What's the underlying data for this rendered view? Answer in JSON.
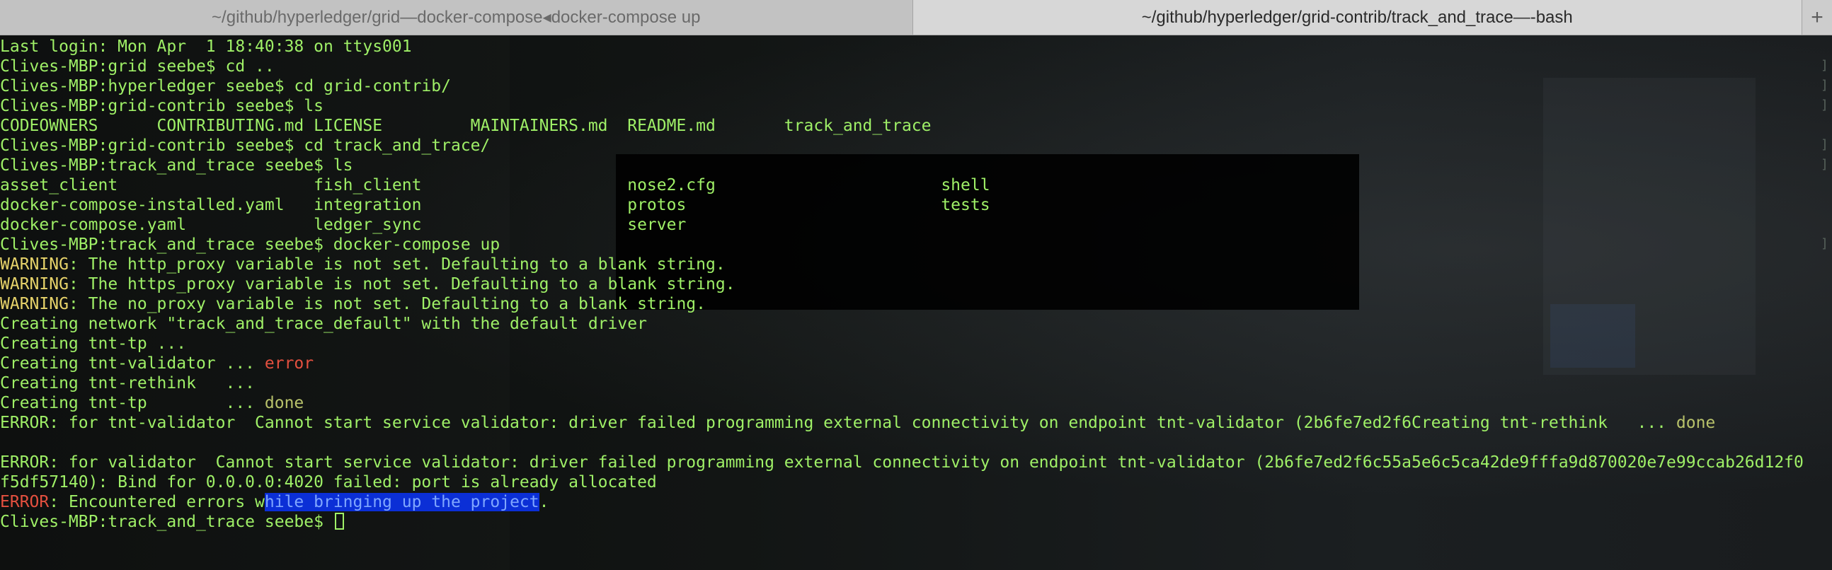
{
  "tabs": [
    {
      "title_path": "~/github/hyperledger/grid",
      "title_sep": " — ",
      "title_proc": "docker-compose",
      "title_arrow": " ◂ ",
      "title_cmd": "docker-compose up",
      "active": false
    },
    {
      "title_path": "~/github/hyperledger/grid-contrib/track_and_trace",
      "title_sep": " — ",
      "title_proc": "-bash",
      "active": true
    }
  ],
  "new_tab_label": "+",
  "terminal": {
    "login": "Last login: Mon Apr  1 18:40:38 on ttys001",
    "p1": "Clives-MBP:grid seebe$ cd ..",
    "p2": "Clives-MBP:hyperledger seebe$ cd grid-contrib/",
    "p3": "Clives-MBP:grid-contrib seebe$ ls",
    "ls1": "CODEOWNERS      CONTRIBUTING.md LICENSE         MAINTAINERS.md  README.md       track_and_trace",
    "p4": "Clives-MBP:grid-contrib seebe$ cd track_and_trace/",
    "p5": "Clives-MBP:track_and_trace seebe$ ls",
    "ls2a": "asset_client                    fish_client                     nose2.cfg                       shell",
    "ls2b": "docker-compose-installed.yaml   integration                     protos                          tests",
    "ls2c": "docker-compose.yaml             ledger_sync                     server",
    "p6": "Clives-MBP:track_and_trace seebe$ docker-compose up",
    "warn_label": "WARNING",
    "w1": ": The http_proxy variable is not set. Defaulting to a blank string.",
    "w2": ": The https_proxy variable is not set. Defaulting to a blank string.",
    "w3": ": The no_proxy variable is not set. Defaulting to a blank string.",
    "net": "Creating network \"track_and_trace_default\" with the default driver",
    "c1": "Creating tnt-tp ...",
    "c2": "Creating tnt-validator ... ",
    "c2_status": "error",
    "c3": "Creating tnt-rethink   ...",
    "c4": "Creating tnt-tp        ... ",
    "c4_status": "done",
    "e1": "ERROR: for tnt-validator  Cannot start service validator: driver failed programming external connectivity on endpoint tnt-validator (2b6fe7ed2f6Creating tnt-rethink   ... ",
    "e1_status": "done",
    "e2": "ERROR: for validator  Cannot start service validator: driver failed programming external connectivity on endpoint tnt-validator (2b6fe7ed2f6c55a5e6c5ca42de9fffa9d870020e7e99ccab26d12f0",
    "e2b": "f5df57140): Bind for 0.0.0.0:4020 failed: port is already allocated",
    "err_label": "ERROR",
    "e3_pre": ": Encountered errors w",
    "e3_sel": "hile bringing up the project",
    "e3_post": ".",
    "p7": "Clives-MBP:track_and_trace seebe$ "
  },
  "colors": {
    "prompt_green": "#9ff067",
    "warning_yellow": "#e7d36a",
    "error_red": "#e4503f",
    "selection_blue": "#0b2fd6"
  }
}
